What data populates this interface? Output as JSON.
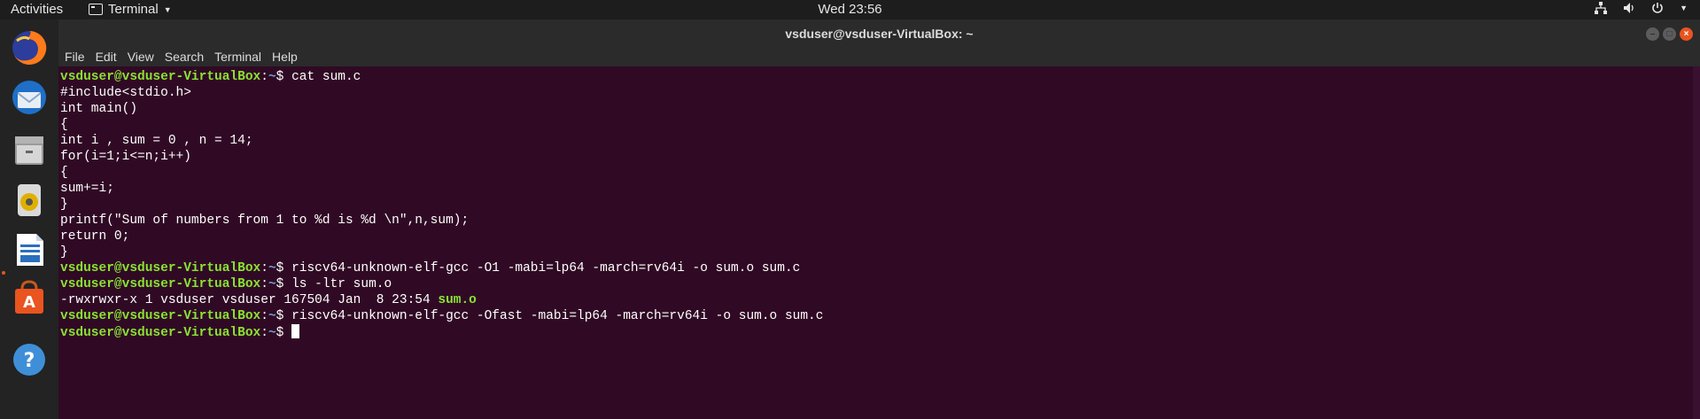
{
  "topbar": {
    "activities": "Activities",
    "app_name": "Terminal",
    "clock": "Wed 23:56",
    "tray_icons": [
      "network-icon",
      "volume-icon",
      "power-icon",
      "chevron-down-icon"
    ]
  },
  "dock": {
    "items": [
      "firefox-icon",
      "thunderbird-icon",
      "files-icon",
      "rhythmbox-icon",
      "writer-icon",
      "software-icon",
      "help-icon"
    ]
  },
  "window": {
    "title": "vsduser@vsduser-VirtualBox: ~",
    "menu": [
      "File",
      "Edit",
      "View",
      "Search",
      "Terminal",
      "Help"
    ]
  },
  "terminal": {
    "prompt_user": "vsduser@vsduser-VirtualBox",
    "prompt_sep": ":",
    "prompt_path": "~",
    "prompt_end": "$ ",
    "cmd1": "cat sum.c",
    "code": [
      "#include<stdio.h>",
      "int main()",
      "{",
      "int i , sum = 0 , n = 14;",
      "for(i=1;i<=n;i++)",
      "{",
      "sum+=i;",
      "}",
      "printf(\"Sum of numbers from 1 to %d is %d \\n\",n,sum);",
      "return 0;",
      "}"
    ],
    "cmd2": "riscv64-unknown-elf-gcc -O1 -mabi=lp64 -march=rv64i -o sum.o sum.c",
    "cmd3": "ls -ltr sum.o",
    "ls_out": "-rwxrwxr-x 1 vsduser vsduser 167504 Jan  8 23:54 ",
    "ls_file": "sum.o",
    "cmd4": "riscv64-unknown-elf-gcc -Ofast -mabi=lp64 -march=rv64i -o sum.o sum.c"
  }
}
